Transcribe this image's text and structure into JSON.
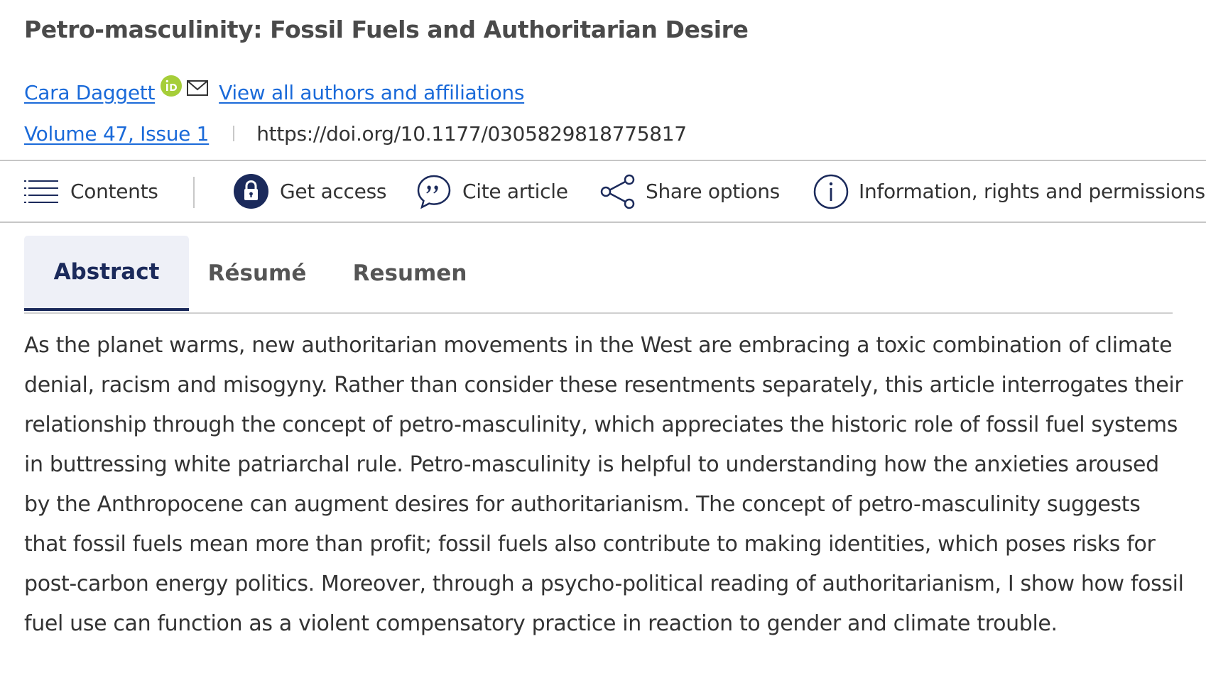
{
  "article": {
    "title": "Petro-masculinity: Fossil Fuels and Authoritarian Desire",
    "author": "Cara Daggett",
    "all_authors_link": "View all authors and affiliations",
    "volume_issue": "Volume 47, Issue 1",
    "doi": "https://doi.org/10.1177/0305829818775817"
  },
  "toolbar": {
    "contents": "Contents",
    "get_access": "Get access",
    "cite": "Cite article",
    "share": "Share options",
    "info": "Information, rights and permissions"
  },
  "tabs": [
    {
      "label": "Abstract",
      "active": true
    },
    {
      "label": "Résumé",
      "active": false
    },
    {
      "label": "Resumen",
      "active": false
    }
  ],
  "abstract": "As the planet warms, new authoritarian movements in the West are embracing a toxic combination of climate denial, racism and misogyny. Rather than consider these resentments separately, this article interrogates their relationship through the concept of petro-masculinity, which appreciates the historic role of fossil fuel systems in buttressing white patriarchal rule. Petro-masculinity is helpful to understanding how the anxieties aroused by the Anthropocene can augment desires for authoritarianism. The concept of petro-masculinity suggests that fossil fuels mean more than profit; fossil fuels also contribute to making identities, which poses risks for post-carbon energy politics. Moreover, through a psycho-political reading of authoritarianism, I show how fossil fuel use can function as a violent compensatory practice in reaction to gender and climate trouble.",
  "icons": {
    "orcid": "orcid-icon",
    "mail": "mail-icon",
    "contents": "hamburger-menu-icon",
    "access": "lock-icon",
    "cite": "quote-bubble-icon",
    "share": "share-icon",
    "info": "info-icon"
  },
  "colors": {
    "link": "#1a6ad9",
    "navy": "#1b2a5b",
    "orcid": "#a6ce39",
    "active_tab_bg": "#eef0f7"
  }
}
